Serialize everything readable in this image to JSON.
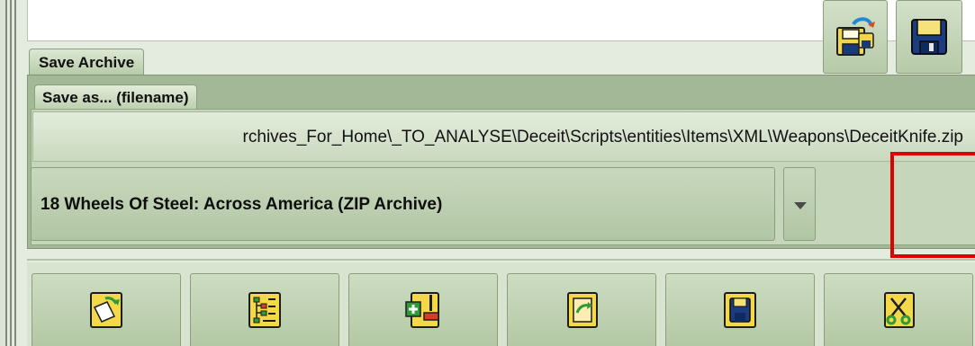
{
  "archive_tab": {
    "label": "Save Archive"
  },
  "filename_tab": {
    "label": "Save as... (filename)"
  },
  "filename": {
    "value": "rchives_For_Home\\_TO_ANALYSE\\Deceit\\Scripts\\entities\\Items\\XML\\Weapons\\DeceitKnife.zip"
  },
  "format": {
    "selected": "18 Wheels Of Steel: Across America (ZIP Archive)"
  },
  "buttons": {
    "dropdown": "chevron-down-icon",
    "convert": "disk-convert-icon",
    "save": "floppy-disk-icon"
  },
  "toolbar": [
    {
      "icon": "open-archive-icon"
    },
    {
      "icon": "tree-list-icon"
    },
    {
      "icon": "add-remove-icon"
    },
    {
      "icon": "extract-icon"
    },
    {
      "icon": "floppy-disk-icon"
    },
    {
      "icon": "cut-icon"
    }
  ],
  "colors": {
    "highlight": "#e00000",
    "panel": "#a2b896",
    "accent": "#f3d84a"
  }
}
